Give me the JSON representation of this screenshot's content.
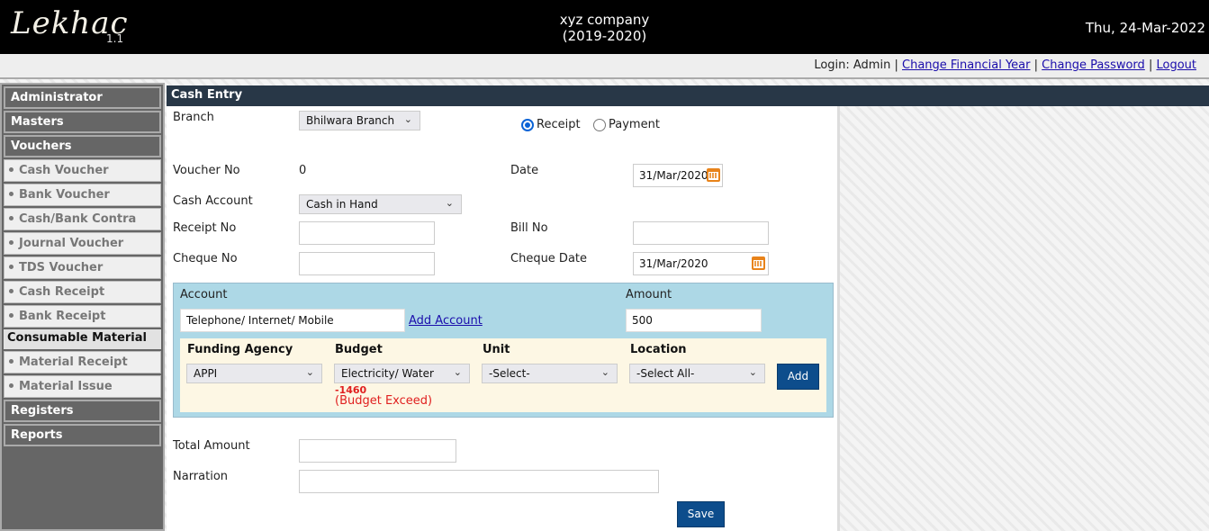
{
  "header": {
    "app_name": "Lekhac",
    "version": "1.1",
    "company_name": "xyz company",
    "financial_year": "(2019-2020)",
    "current_date": "Thu, 24-Mar-2022"
  },
  "login_bar": {
    "login_text": "Login: Admin",
    "separator": "|",
    "change_financial_year": "Change Financial Year",
    "change_password": "Change Password",
    "logout": "Logout"
  },
  "sidebar": {
    "administrator": "Administrator",
    "masters": "Masters",
    "vouchers": "Vouchers",
    "voucher_items": [
      "Cash Voucher",
      "Bank Voucher",
      "Cash/Bank Contra",
      "Journal Voucher",
      "TDS Voucher",
      "Cash Receipt",
      "Bank Receipt"
    ],
    "consumable_material": "Consumable Material",
    "material_items": [
      "Material Receipt",
      "Material Issue"
    ],
    "registers": "Registers",
    "reports": "Reports"
  },
  "form": {
    "title": "Cash Entry",
    "branch_label": "Branch",
    "branch_value": "Bhilwara Branch",
    "type_options": [
      "Receipt",
      "Payment"
    ],
    "type_selected": "Receipt",
    "voucher_no_label": "Voucher No",
    "voucher_no_value": "0",
    "date_label": "Date",
    "date_value": "31/Mar/2020",
    "cash_account_label": "Cash Account",
    "cash_account_value": "Cash in Hand",
    "receipt_no_label": "Receipt No",
    "receipt_no_value": "",
    "bill_no_label": "Bill No",
    "bill_no_value": "",
    "cheque_no_label": "Cheque No",
    "cheque_no_value": "",
    "cheque_date_label": "Cheque Date",
    "cheque_date_value": "31/Mar/2020",
    "account_label": "Account",
    "account_value": "Telephone/  Internet/ Mobile",
    "add_account_link": "Add Account",
    "amount_label": "Amount",
    "amount_value": "500",
    "funding_agency_label": "Funding Agency",
    "funding_agency_value": "APPI",
    "budget_label": "Budget",
    "budget_value": "Electricity/ Water",
    "budget_balance": "-1460",
    "budget_warning": "(Budget Exceed)",
    "unit_label": "Unit",
    "unit_value": "-Select-",
    "location_label": "Location",
    "location_value": "-Select All-",
    "add_button": "Add",
    "total_amount_label": "Total Amount",
    "total_amount_value": "",
    "narration_label": "Narration",
    "narration_value": "",
    "save_button": "Save"
  },
  "colors": {
    "header_bg": "#000000",
    "section_header_bg": "#283747",
    "account_box_bg": "#add8e6",
    "funding_box_bg": "#fdf7e4",
    "button_bg": "#0d4d8c",
    "warning": "#e02020",
    "sidebar_bg": "#666666"
  }
}
